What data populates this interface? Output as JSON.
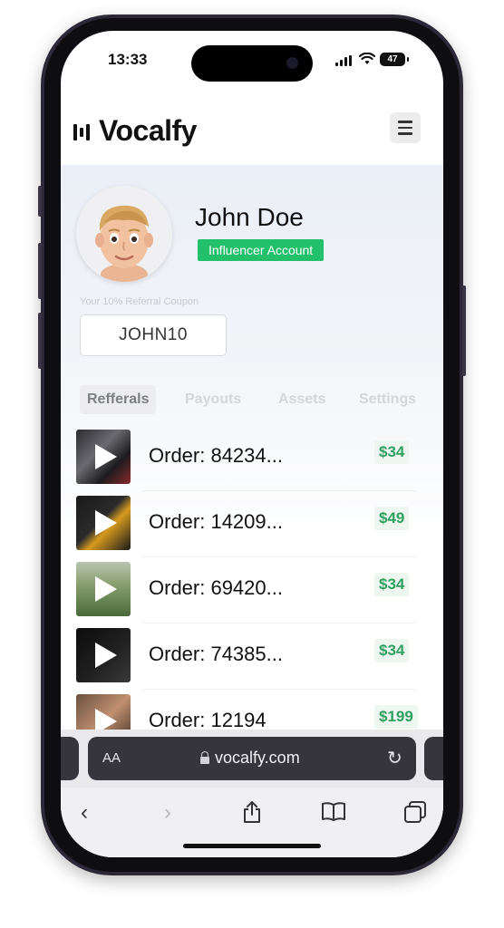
{
  "status_bar": {
    "time": "13:33",
    "battery": "47"
  },
  "header": {
    "logo_text": "Vocalfy",
    "menu_icon": "hamburger-menu-icon"
  },
  "profile": {
    "name": "John Doe",
    "badge": "Influencer Account",
    "coupon_label": "Your 10% Referral Coupon",
    "coupon_code": "JOHN10"
  },
  "tabs": [
    {
      "label": "Refferals",
      "active": true
    },
    {
      "label": "Payouts",
      "active": false
    },
    {
      "label": "Assets",
      "active": false
    },
    {
      "label": "Settings",
      "active": false
    }
  ],
  "orders": [
    {
      "label": "Order: 84234...",
      "price": "$34"
    },
    {
      "label": "Order: 14209...",
      "price": "$49"
    },
    {
      "label": "Order: 69420...",
      "price": "$34"
    },
    {
      "label": "Order: 74385...",
      "price": "$34"
    },
    {
      "label": "Order: 12194",
      "price": "$199"
    }
  ],
  "browser": {
    "text_size": "AA",
    "url": "vocalfy.com"
  },
  "colors": {
    "accent_green": "#22c06a",
    "price_green": "#2fa060"
  }
}
